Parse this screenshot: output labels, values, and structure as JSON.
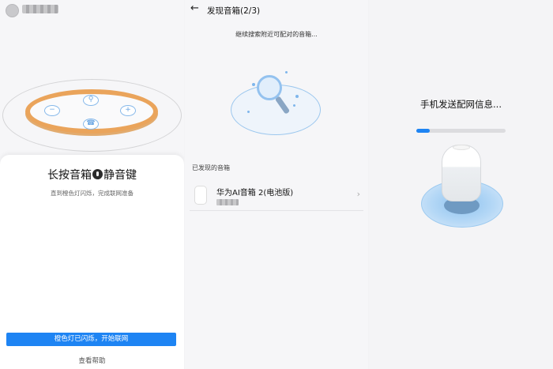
{
  "panel1": {
    "instruction_title_before": "长按音箱",
    "instruction_title_after": "静音键",
    "instruction_sub": "直到橙色灯闪烁，完成联网准备",
    "device_buttons": [
      "−",
      "⚲",
      "+",
      "☎"
    ],
    "primary_button": "橙色灯已闪烁，开始联网",
    "help_link": "查看帮助",
    "accent_color": "#1e84f3",
    "ring_color": "#eaa45b"
  },
  "panel2": {
    "back_icon": "←",
    "title": "发现音箱(2/3)",
    "search_status": "继续搜索附近可配对的音箱...",
    "found_label": "已发现的音箱",
    "devices": [
      {
        "name": "华为AI音箱 2(电池版)",
        "chevron": "›"
      }
    ]
  },
  "panel3": {
    "status": "手机发送配网信息...",
    "progress": 0.15
  }
}
